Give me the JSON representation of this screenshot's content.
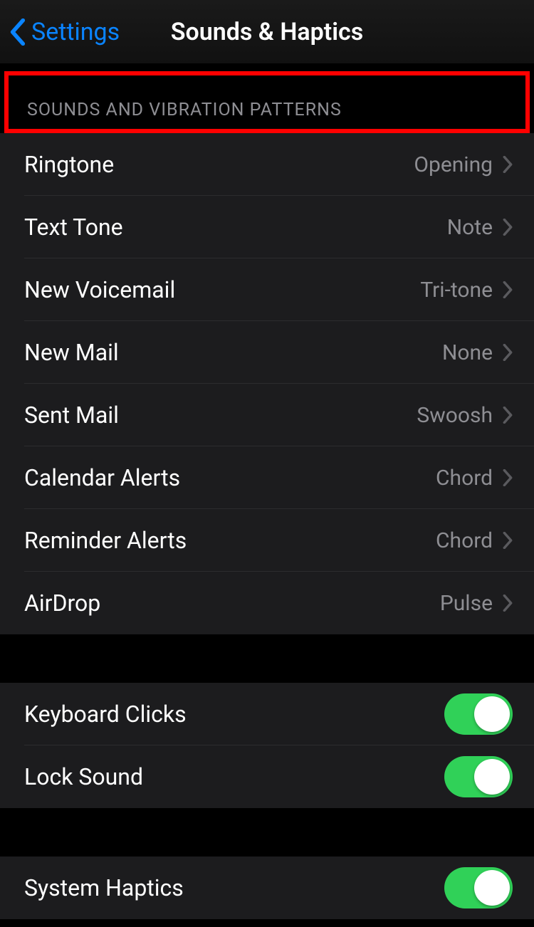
{
  "nav": {
    "back_label": "Settings",
    "title": "Sounds & Haptics"
  },
  "section_sounds": {
    "header": "SOUNDS AND VIBRATION PATTERNS",
    "rows": [
      {
        "label": "Ringtone",
        "value": "Opening"
      },
      {
        "label": "Text Tone",
        "value": "Note"
      },
      {
        "label": "New Voicemail",
        "value": "Tri-tone"
      },
      {
        "label": "New Mail",
        "value": "None"
      },
      {
        "label": "Sent Mail",
        "value": "Swoosh"
      },
      {
        "label": "Calendar Alerts",
        "value": "Chord"
      },
      {
        "label": "Reminder Alerts",
        "value": "Chord"
      },
      {
        "label": "AirDrop",
        "value": "Pulse"
      }
    ]
  },
  "section_toggles_a": {
    "rows": [
      {
        "label": "Keyboard Clicks",
        "on": true
      },
      {
        "label": "Lock Sound",
        "on": true
      }
    ]
  },
  "section_toggles_b": {
    "rows": [
      {
        "label": "System Haptics",
        "on": true
      }
    ]
  }
}
